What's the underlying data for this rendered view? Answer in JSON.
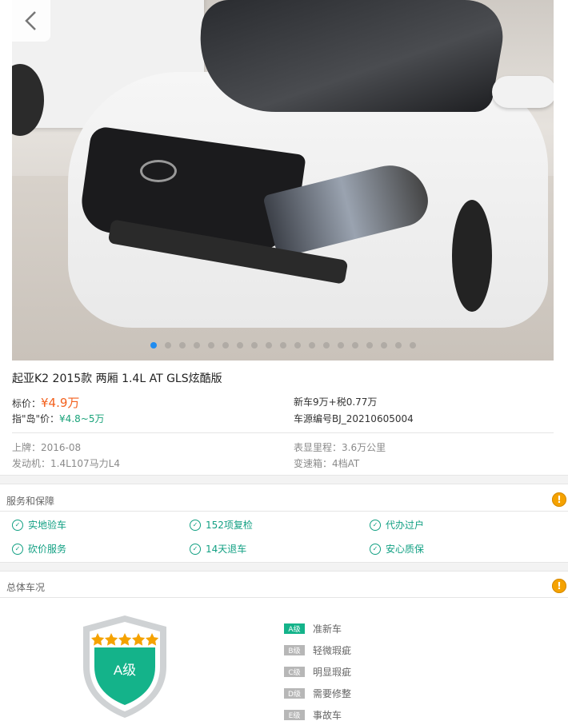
{
  "gallery": {
    "slide_count": 19,
    "active_slide": 1
  },
  "car_title": "起亚K2 2015款 两厢 1.4L AT GLS炫酷版",
  "prices": {
    "list_label": "标价：",
    "list_value": "¥4.9万",
    "guide_label": "指\"岛\"价：",
    "guide_value": "¥4.8~5万",
    "new_car": "新车9万+税0.77万",
    "source_id": "车源编号BJ_20210605004"
  },
  "specs": {
    "reg": "上牌：2016-08",
    "mileage": "表显里程：3.6万公里",
    "engine": "发动机：1.4L107马力L4",
    "gearbox": "变速箱：4档AT"
  },
  "services": {
    "title": "服务和保障",
    "items": [
      "实地验车",
      "152项复检",
      "代办过户",
      "砍价服务",
      "14天退车",
      "安心质保"
    ]
  },
  "condition": {
    "title": "总体车况",
    "grade_label": "A级",
    "grades": [
      {
        "badge": "A级",
        "text": "准新车"
      },
      {
        "badge": "B级",
        "text": "轻微瑕疵"
      },
      {
        "badge": "C级",
        "text": "明显瑕疵"
      },
      {
        "badge": "D级",
        "text": "需要修整"
      },
      {
        "badge": "E级",
        "text": "事故车"
      }
    ],
    "stars": 5
  },
  "colors": {
    "accent_orange": "#f3611e",
    "accent_green": "#14b38a",
    "active_dot": "#1f8cf0"
  }
}
